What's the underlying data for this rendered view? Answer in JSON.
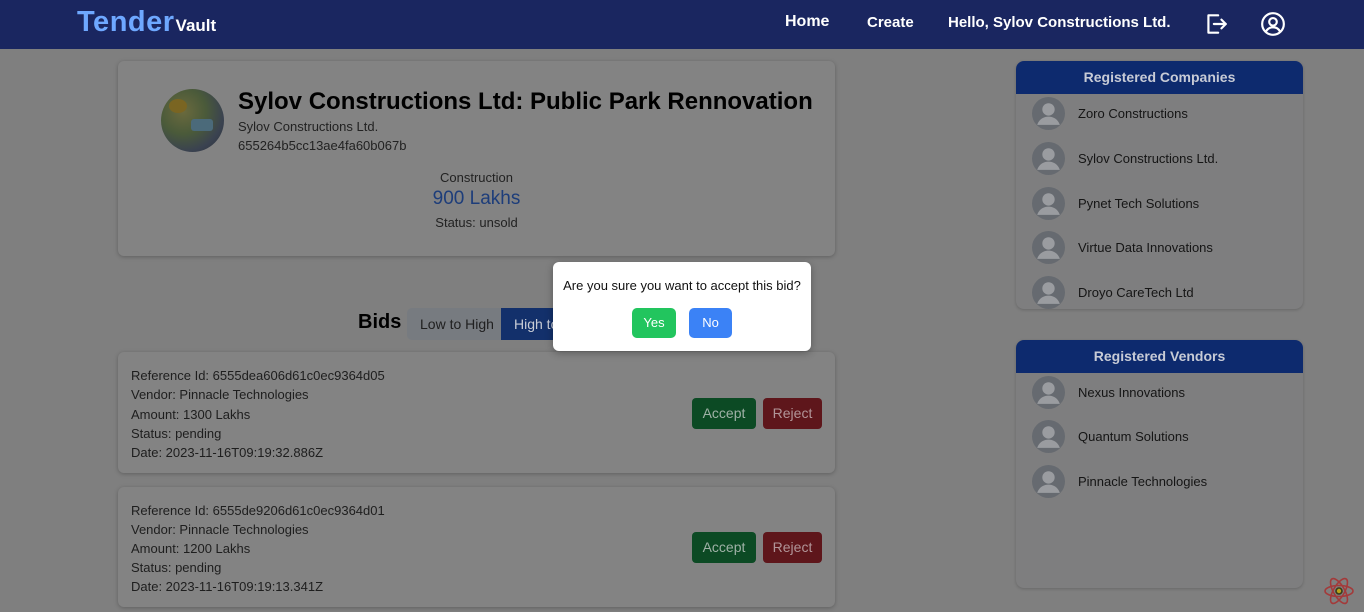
{
  "navbar": {
    "brand_main": "Tender",
    "brand_sub": "Vault",
    "home": "Home",
    "create": "Create",
    "greeting": "Hello, Sylov Constructions Ltd."
  },
  "tender": {
    "title": "Sylov Constructions Ltd: Public Park Rennovation",
    "owner": "Sylov Constructions Ltd.",
    "id": "655264b5cc13ae4fa60b067b",
    "category": "Construction",
    "amount": "900 Lakhs",
    "status": "Status: unsold"
  },
  "bids": {
    "title": "Bids",
    "sort_low": "Low to High",
    "sort_high": "High to Low",
    "items": [
      {
        "ref": "Reference Id: 6555dea606d61c0ec9364d05",
        "vendor": "Vendor: Pinnacle Technologies",
        "amount": "Amount: 1300 Lakhs",
        "status": "Status: pending",
        "date": "Date: 2023-11-16T09:19:32.886Z",
        "accept": "Accept",
        "reject": "Reject"
      },
      {
        "ref": "Reference Id: 6555de9206d61c0ec9364d01",
        "vendor": "Vendor: Pinnacle Technologies",
        "amount": "Amount: 1200 Lakhs",
        "status": "Status: pending",
        "date": "Date: 2023-11-16T09:19:13.341Z",
        "accept": "Accept",
        "reject": "Reject"
      }
    ]
  },
  "companies": {
    "title": "Registered Companies",
    "items": [
      "Zoro Constructions",
      "Sylov Constructions Ltd.",
      "Pynet Tech Solutions",
      "Virtue Data Innovations",
      "Droyo CareTech Ltd"
    ]
  },
  "vendors": {
    "title": "Registered Vendors",
    "items": [
      "Nexus Innovations",
      "Quantum Solutions",
      "Pinnacle Technologies"
    ]
  },
  "modal": {
    "message": "Are you sure you want to accept this bid?",
    "yes": "Yes",
    "no": "No"
  },
  "colors": {
    "navbar": "#1a2660",
    "accent_blue": "#3b82f6",
    "yes_green": "#22c55e"
  }
}
